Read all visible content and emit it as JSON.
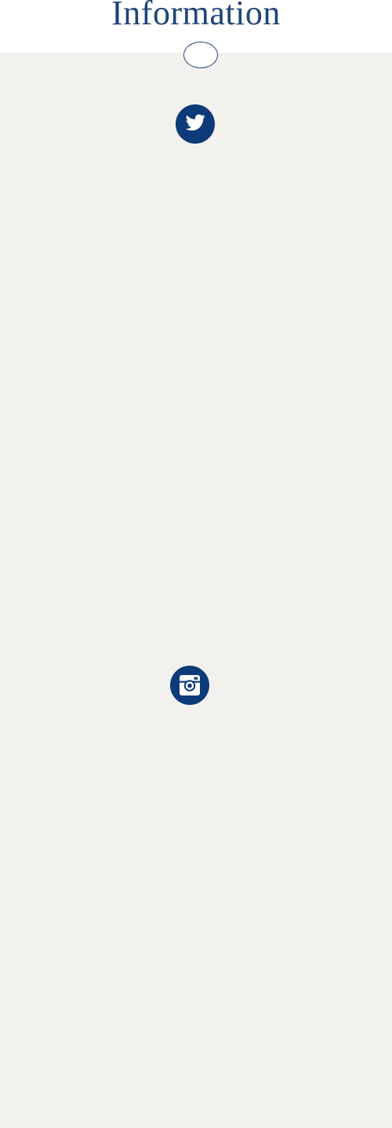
{
  "page": {
    "title": "Information"
  },
  "social": {
    "twitter": {
      "icon": "twitter-bird-icon"
    },
    "instagram": {
      "icon": "instagram-camera-icon"
    }
  },
  "colors": {
    "brand_navy": "#1e4477",
    "icon_background": "#0d3a78",
    "page_background": "#f2f1ee",
    "header_background": "#ffffff"
  }
}
